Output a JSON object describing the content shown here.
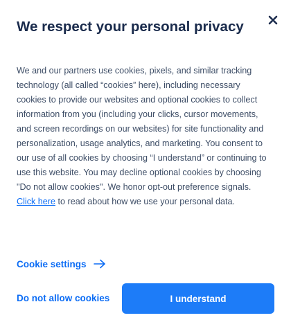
{
  "dialog": {
    "title": "We respect your personal privacy",
    "body_part1": "We and our partners use cookies, pixels, and similar tracking technology (all called “cookies” here), including necessary cookies to provide our websites and optional cookies to collect information from you (including your clicks, cursor movements, and screen recordings on our websites) for site functionality and personalization, usage analytics, and marketing. You consent to our use of all cookies by choosing “I understand” or continuing to use this website. You may decline optional cookies by choosing \"Do not allow cookies\". We honor opt-out preference signals. ",
    "link_text": "Click here",
    "body_part2": " to read about how we use your personal data.",
    "settings_label": "Cookie settings",
    "deny_label": "Do not allow cookies",
    "accept_label": "I understand"
  },
  "icons": {
    "close": "close-icon",
    "settings_arrow": "arrow-right-icon"
  },
  "colors": {
    "title": "#1a2b4c",
    "body": "#3d4d66",
    "accent": "#0b6cf5",
    "button_bg": "#1d7cf8"
  }
}
